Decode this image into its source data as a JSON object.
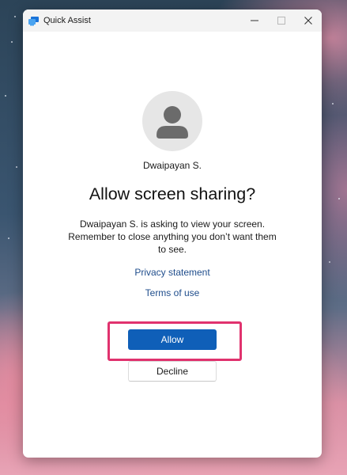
{
  "window": {
    "title": "Quick Assist",
    "app_icon": "quick-assist-icon",
    "controls": {
      "minimize_icon": "minimize-icon",
      "maximize_icon": "maximize-icon",
      "close_icon": "close-icon"
    }
  },
  "dialog": {
    "avatar_icon": "person-icon",
    "requester_name": "Dwaipayan S.",
    "heading": "Allow screen sharing?",
    "message": "Dwaipayan S. is asking to view your screen. Remember to close anything you don’t want them to see.",
    "links": {
      "privacy": "Privacy statement",
      "terms": "Terms of use"
    },
    "buttons": {
      "allow": "Allow",
      "decline": "Decline"
    }
  },
  "colors": {
    "accent": "#0f5fb8",
    "link": "#1f4d8c",
    "highlight": "#e0326e"
  }
}
